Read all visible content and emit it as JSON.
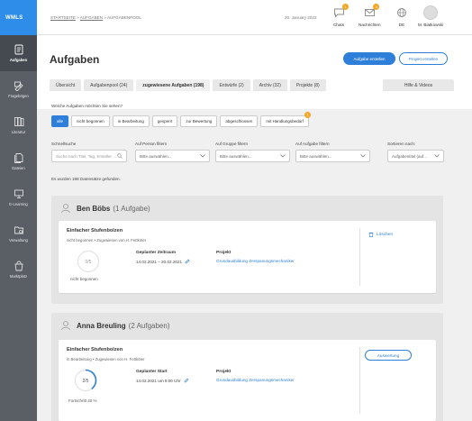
{
  "app": {
    "logo": "WMLS"
  },
  "sidebar": {
    "items": [
      {
        "label": "Aufgaben",
        "icon": "tasks-icon",
        "active": true
      },
      {
        "label": "Fragebögen",
        "icon": "questionnaire-icon"
      },
      {
        "label": "Literatur",
        "icon": "literature-icon"
      },
      {
        "label": "Dateien",
        "icon": "files-icon"
      },
      {
        "label": "E-Learning",
        "icon": "elearning-icon"
      },
      {
        "label": "Verwaltung",
        "icon": "administration-icon"
      },
      {
        "label": "Marktplatz",
        "icon": "marketplace-icon"
      }
    ]
  },
  "topbar": {
    "breadcrumb": {
      "home": "STARTSEITE",
      "sep1": "»",
      "tasks": "AUFGABEN",
      "sep2": "»",
      "current": "AUFGABENPOOL"
    },
    "date": "20. January 2022",
    "chats": {
      "label": "Chats",
      "badge": "1"
    },
    "messages": {
      "label": "Nachrichten",
      "badge": "4"
    },
    "language": {
      "label": "DE"
    },
    "user": {
      "label": "M. Biatkowski"
    }
  },
  "header": {
    "title": "Aufgaben",
    "create_button": "Aufgabe erstellen",
    "project_button": "Projekt erstellen",
    "tabs": [
      {
        "label": "Übersicht"
      },
      {
        "label": "Aufgabenpool (24)"
      },
      {
        "label": "zugewiesene Aufgaben (198)",
        "active": true
      },
      {
        "label": "Entwürfe (2)"
      },
      {
        "label": "Archiv (32)"
      },
      {
        "label": "Projekte (8)"
      }
    ],
    "help_tab": "Hilfe & Videos"
  },
  "filters": {
    "question": "Welche Aufgaben möchten Sie sehen?",
    "chips": [
      {
        "label": "alle",
        "active": true
      },
      {
        "label": "nicht begonnen"
      },
      {
        "label": "in Bearbeitung"
      },
      {
        "label": "gesperrt"
      },
      {
        "label": "zur Bewertung"
      },
      {
        "label": "abgeschlossen"
      },
      {
        "label": "mit Handlungsbedarf",
        "badge": "3"
      }
    ],
    "quick_search": {
      "label": "Schnellsuche",
      "placeholder": "Suche nach Titel, Tag, Ersteller ..."
    },
    "person": {
      "label": "Auf Person filtern",
      "value": "Bitte auswählen..."
    },
    "group": {
      "label": "Auf Gruppe filtern",
      "value": "Bitte auswählen..."
    },
    "task": {
      "label": "Auf Aufgabe filtern",
      "value": "Bitte auswählen..."
    },
    "sort": {
      "label": "Sortieren nach:",
      "value": "Aufgabentitel (auf..."
    }
  },
  "result_text": "Es wurden 198 Datensätze gefunden.",
  "groups": [
    {
      "name": "Ben Böbs",
      "count": "(1 Aufgabe)",
      "card": {
        "title": "Einfacher Stufenbolzen",
        "status": "nicht begonnen",
        "assigned": "Zugewiesen von H. Fettköter",
        "progress_text": "0/5",
        "progress_fraction": 0,
        "progress_label": "nicht begonnen",
        "period_label": "Geplanter Zeitraum",
        "period_value": "14.02.2021 – 20.02.2021",
        "project_label": "Projekt",
        "project_value": "Grundausbildung Zerspanungsmechaniker",
        "action": "Löschen"
      }
    },
    {
      "name": "Anna Breuling",
      "count": "(2 Aufgaben)",
      "card": {
        "title": "Einfacher Stufenbolzen",
        "status": "in Bearbeitung",
        "assigned": "Zugewiesen von H. Fettköter",
        "progress_text": "2/5",
        "progress_fraction": 0.4,
        "progress_label": "Fortschritt 40 %",
        "period_label": "Geplanter Start",
        "period_value": "14.02.2021 um 9:00 Uhr",
        "project_label": "Projekt",
        "project_value": "Grundausbildung Zerspanungsmechaniker",
        "action": "Auswertung"
      }
    }
  ],
  "colors": {
    "accent": "#2e7fd9",
    "badge": "#f5a623",
    "sidebar": "#5a5f66"
  }
}
